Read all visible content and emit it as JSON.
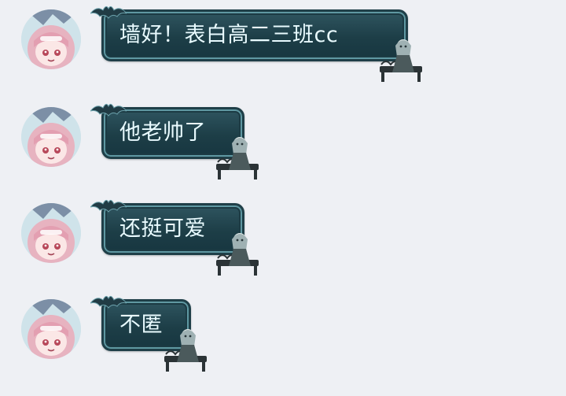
{
  "conversation": {
    "messages": [
      {
        "text": "墙好！表白高二三班cc"
      },
      {
        "text": "他老帅了"
      },
      {
        "text": "还挺可爱"
      },
      {
        "text": "不匿"
      }
    ]
  },
  "theme": {
    "page_background": "#eef0f4",
    "bubble_fill": "#1d3e47",
    "bubble_border": "#5f98a2",
    "bubble_text_color": "#e9fbff",
    "avatar_hair_color": "#e8b7c2"
  }
}
